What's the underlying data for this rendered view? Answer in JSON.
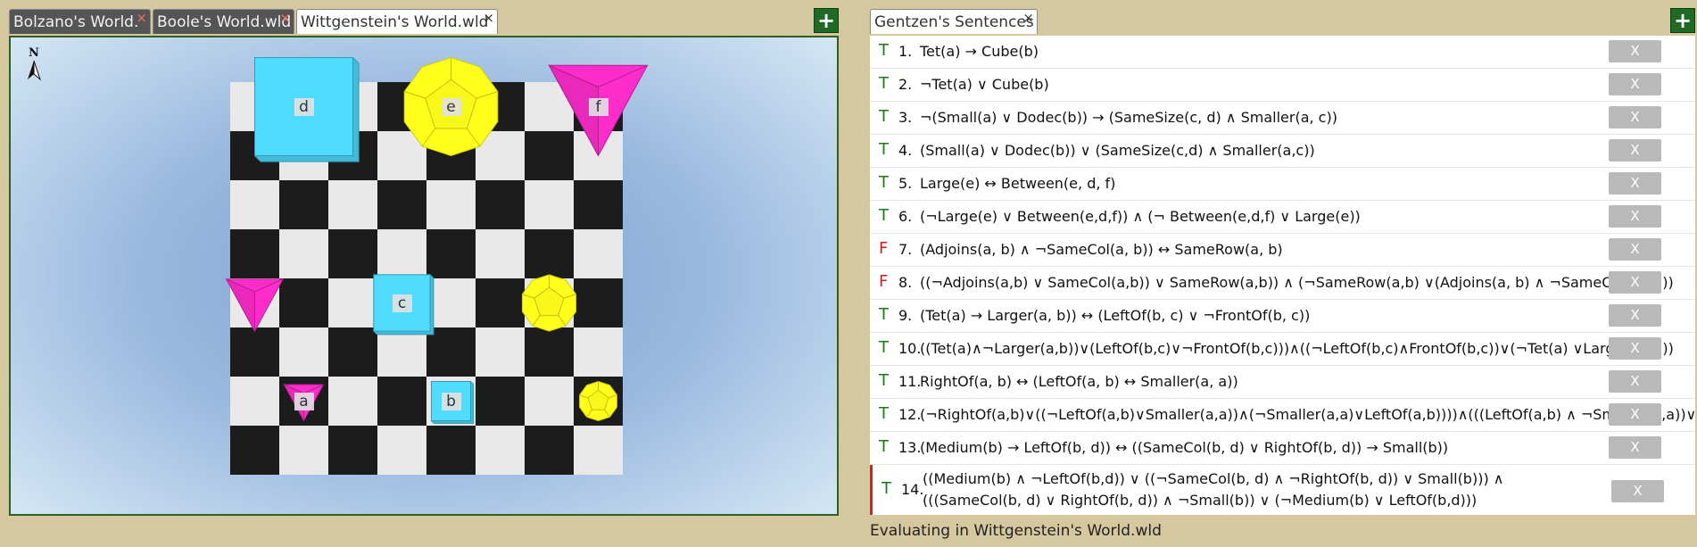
{
  "world_tabs": [
    {
      "label": "Bolzano's World.",
      "active": false
    },
    {
      "label": "Boole's World.wld",
      "active": false
    },
    {
      "label": "Wittgenstein's World.wld",
      "active": true
    }
  ],
  "close_glyph": "×",
  "add_label": "+",
  "compass_label": "N",
  "blocks": [
    {
      "name": "a",
      "shape": "tet",
      "size": "small",
      "col": 1,
      "row": 6,
      "color": "#ff2ccc"
    },
    {
      "name": "b",
      "shape": "cube",
      "size": "small",
      "col": 4,
      "row": 6,
      "color": "#4fdcff"
    },
    {
      "name": "c",
      "shape": "cube",
      "size": "medium",
      "col": 3,
      "row": 4,
      "color": "#4fdcff"
    },
    {
      "name": "d",
      "shape": "cube",
      "size": "large",
      "col": 1,
      "row": 0,
      "color": "#4fdcff"
    },
    {
      "name": "e",
      "shape": "dodec",
      "size": "large",
      "col": 4,
      "row": 0,
      "color": "#ffff1a"
    },
    {
      "name": "f",
      "shape": "tet",
      "size": "large",
      "col": 7,
      "row": 0,
      "color": "#ff2ccc"
    },
    {
      "name": "",
      "shape": "tet",
      "size": "medium",
      "col": 0,
      "row": 4,
      "color": "#ff2ccc"
    },
    {
      "name": "",
      "shape": "dodec",
      "size": "medium",
      "col": 6,
      "row": 4,
      "color": "#ffff1a"
    },
    {
      "name": "",
      "shape": "dodec",
      "size": "small",
      "col": 7,
      "row": 6,
      "color": "#ffff1a"
    }
  ],
  "sentence_tab": {
    "label": "Gentzen's Sentences"
  },
  "delete_label": "X",
  "sentences": [
    {
      "tv": "T",
      "num": "1.",
      "text": "Tet(a) → Cube(b)"
    },
    {
      "tv": "T",
      "num": "2.",
      "text": "¬Tet(a) ∨ Cube(b)"
    },
    {
      "tv": "T",
      "num": "3.",
      "text": " ¬(Small(a) ∨ Dodec(b)) → (SameSize(c, d) ∧ Smaller(a, c))"
    },
    {
      "tv": "T",
      "num": "4.",
      "text": "(Small(a) ∨ Dodec(b)) ∨ (SameSize(c,d) ∧ Smaller(a,c))"
    },
    {
      "tv": "T",
      "num": "5.",
      "text": "Large(e) ↔ Between(e, d, f)"
    },
    {
      "tv": "T",
      "num": "6.",
      "text": "(¬Large(e) ∨ Between(e,d,f)) ∧ (¬ Between(e,d,f) ∨ Large(e))"
    },
    {
      "tv": "F",
      "num": "7.",
      "text": "(Adjoins(a, b) ∧ ¬SameCol(a, b)) ↔ SameRow(a, b)"
    },
    {
      "tv": "F",
      "num": "8.",
      "text": "((¬Adjoins(a,b) ∨ SameCol(a,b)) ∨ SameRow(a,b)) ∧ (¬SameRow(a,b) ∨(Adjoins(a, b) ∧ ¬SameCol(a, b)))"
    },
    {
      "tv": "T",
      "num": "9.",
      "text": "(Tet(a) → Larger(a, b)) ↔ (LeftOf(b, c) ∨ ¬FrontOf(b, c))"
    },
    {
      "tv": "T",
      "num": "10.",
      "text": "((Tet(a)∧¬Larger(a,b))∨(LeftOf(b,c)∨¬FrontOf(b,c)))∧((¬LeftOf(b,c)∧FrontOf(b,c))∨(¬Tet(a) ∨Larger(a,b)))"
    },
    {
      "tv": "T",
      "num": "11.",
      "text": "RightOf(a, b) ↔ (LeftOf(a, b) ↔ Smaller(a, a))"
    },
    {
      "tv": "T",
      "num": "12.",
      "text": "(¬RightOf(a,b)∨((¬LeftOf(a,b)∨Smaller(a,a))∧(¬Smaller(a,a)∨LeftOf(a,b))))∧(((LeftOf(a,b) ∧ ¬Smaller(a,a))∨"
    },
    {
      "tv": "T",
      "num": "13.",
      "text": "(Medium(b) → LeftOf(b, d)) ↔ ((SameCol(b, d) ∨ RightOf(b, d)) → Small(b))"
    },
    {
      "tv": "T",
      "num": "14.",
      "text": "((Medium(b) ∧ ¬LeftOf(b,d)) ∨ ((¬SameCol(b, d) ∧ ¬RightOf(b, d)) ∨ Small(b))) ∧",
      "text2": "(((SameCol(b, d) ∨ RightOf(b, d)) ∧ ¬Small(b)) ∨ (¬Medium(b) ∨ LeftOf(b,d)))"
    }
  ],
  "status_text": "Evaluating in Wittgenstein's World.wld"
}
